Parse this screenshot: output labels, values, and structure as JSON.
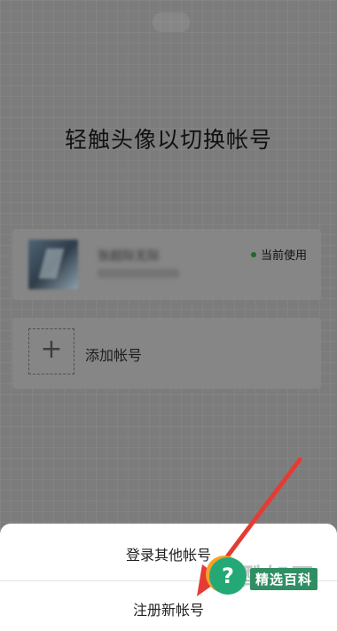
{
  "header": {
    "title": "轻触头像以切换帐号"
  },
  "accounts": [
    {
      "name": "张超际无际",
      "status": "当前使用"
    }
  ],
  "add_account": {
    "plus": "+",
    "label": "添加帐号"
  },
  "sheet": {
    "login_label": "登录其他帐号",
    "register_label": "注册新帐号"
  },
  "watermark": {
    "badge": "?",
    "text": "精选百科",
    "bg_text": "酷知网"
  },
  "colors": {
    "overlay": "#7c7c7c",
    "sheet": "#ffffff",
    "arrow": "#e53b35",
    "status_dot": "#1c6a2c"
  }
}
